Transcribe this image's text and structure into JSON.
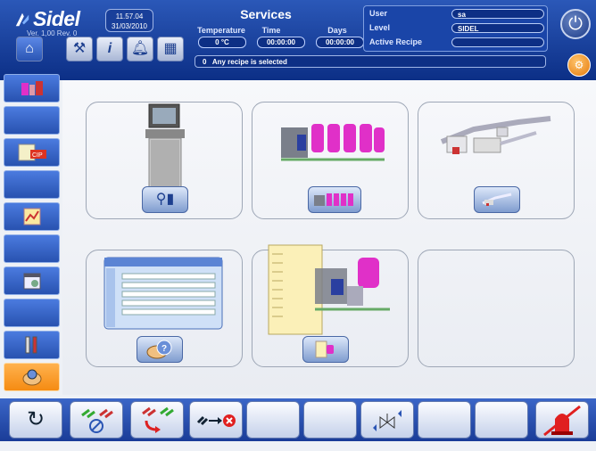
{
  "header": {
    "brand": "Sidel",
    "version": "Ver. 1,00 Rev. 0",
    "time": "11.57.04",
    "date": "31/03/2010",
    "title": "Services",
    "temperature_label": "Temperature",
    "time_label": "Time",
    "days_label": "Days",
    "temperature_value": "0 °C",
    "time_value": "00:00:00",
    "days_value": "00:00:00",
    "user_label": "User",
    "level_label": "Level",
    "active_recipe_label": "Active Recipe",
    "user_value": "sa",
    "level_value": "SIDEL",
    "active_recipe_value": "",
    "message_code": "0",
    "message_text": "Any recipe is selected"
  },
  "colors": {
    "header_blue": "#0c2f86",
    "sidebar_blue": "#2852b0",
    "active_orange": "#f58b12",
    "tank_magenta": "#e030c8"
  },
  "toolbar_icons": [
    "home-icon",
    "wrench-tool-icon",
    "info-icon",
    "bell-icon",
    "machine-status-icon"
  ],
  "sidebar_icons": [
    "line-overview-icon",
    "",
    "cip-icon",
    "",
    "chart-icon",
    "",
    "calendar-icon",
    "",
    "tools-icon",
    "services-hand-icon"
  ],
  "cards": [
    {
      "name": "hmi-terminal"
    },
    {
      "name": "tank-plant"
    },
    {
      "name": "production-line"
    },
    {
      "name": "help-window"
    },
    {
      "name": "plant-documentation"
    },
    {
      "name": "empty"
    }
  ],
  "bottom_icons": [
    "refresh-icon",
    "disable-icon",
    "transfer-icon",
    "stop-icon",
    "",
    "",
    "valve-icon",
    "",
    "",
    "alarm-beacon-icon"
  ]
}
